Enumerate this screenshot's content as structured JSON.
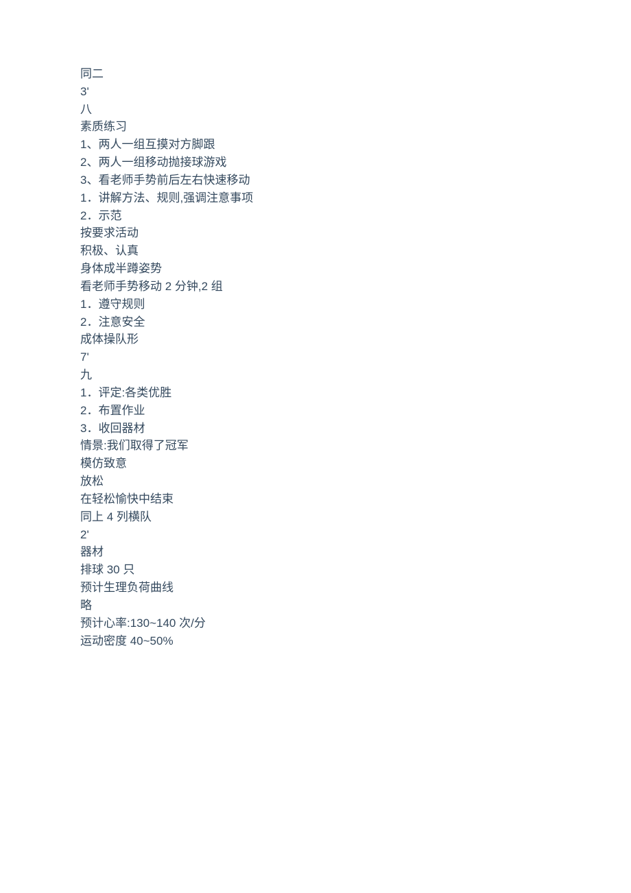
{
  "lines": [
    "同二",
    "3'",
    "八",
    "素质练习",
    "1、两人一组互摸对方脚跟",
    "2、两人一组移动抛接球游戏",
    "3、看老师手势前后左右快速移动",
    "1．讲解方法、规则,强调注意事项",
    "2．示范",
    "按要求活动",
    "积极、认真",
    "身体成半蹲姿势",
    "看老师手势移动 2 分钟,2 组",
    "1．遵守规则",
    "2．注意安全",
    "成体操队形",
    "7'",
    "九",
    "1．评定:各类优胜",
    "2．布置作业",
    "3．收回器材",
    "情景:我们取得了冠军",
    "模仿致意",
    "放松",
    "在轻松愉快中结束",
    "同上 4 列横队",
    "2'",
    "器材",
    "排球 30 只",
    "预计生理负荷曲线",
    "略",
    "预计心率:130~140 次/分",
    "运动密度 40~50%"
  ]
}
